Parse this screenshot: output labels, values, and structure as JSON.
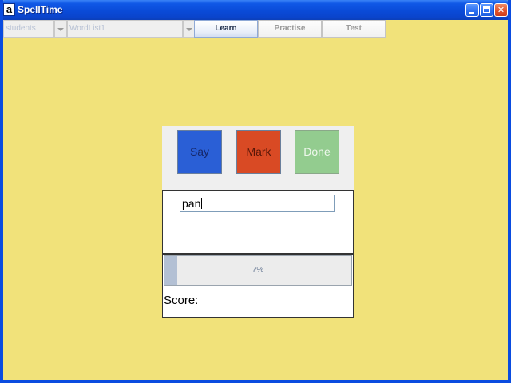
{
  "window": {
    "title": "SpellTime",
    "icon_glyph": "a",
    "background_color": "#f1e27a"
  },
  "toolbar": {
    "students_combo": {
      "selected": "students"
    },
    "wordlist_combo": {
      "selected": "WordList1"
    },
    "tabs": [
      {
        "label": "Learn",
        "active": true
      },
      {
        "label": "Practise",
        "active": false
      },
      {
        "label": "Test",
        "active": false
      }
    ]
  },
  "actions": {
    "say_label": "Say",
    "mark_label": "Mark",
    "done_label": "Done",
    "colors": {
      "say": "#2a5fd6",
      "mark": "#d94a24",
      "done": "#93cc8f"
    }
  },
  "entry": {
    "value": "pan"
  },
  "progress": {
    "percent": 7,
    "label": "7%"
  },
  "score": {
    "label": "Score:"
  }
}
